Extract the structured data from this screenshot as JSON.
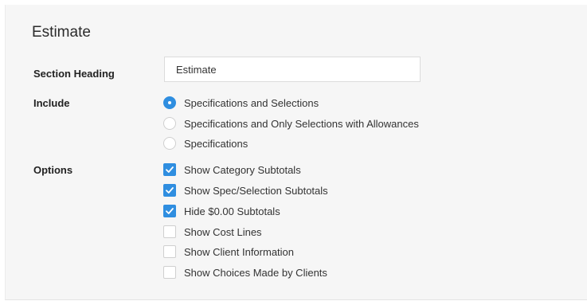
{
  "section": {
    "title": "Estimate",
    "heading_label": "Section Heading",
    "heading_value": "Estimate"
  },
  "include": {
    "label": "Include",
    "options": [
      {
        "label": "Specifications and Selections",
        "selected": true
      },
      {
        "label": "Specifications and Only Selections with Allowances",
        "selected": false
      },
      {
        "label": "Specifications",
        "selected": false
      }
    ]
  },
  "options": {
    "label": "Options",
    "items": [
      {
        "label": "Show Category Subtotals",
        "checked": true
      },
      {
        "label": "Show Spec/Selection Subtotals",
        "checked": true
      },
      {
        "label": "Hide $0.00 Subtotals",
        "checked": true
      },
      {
        "label": "Show Cost Lines",
        "checked": false
      },
      {
        "label": "Show Client Information",
        "checked": false
      },
      {
        "label": "Show Choices Made by Clients",
        "checked": false
      }
    ]
  },
  "colors": {
    "accent": "#2f8ee0",
    "panel_bg": "#f6f6f6"
  }
}
